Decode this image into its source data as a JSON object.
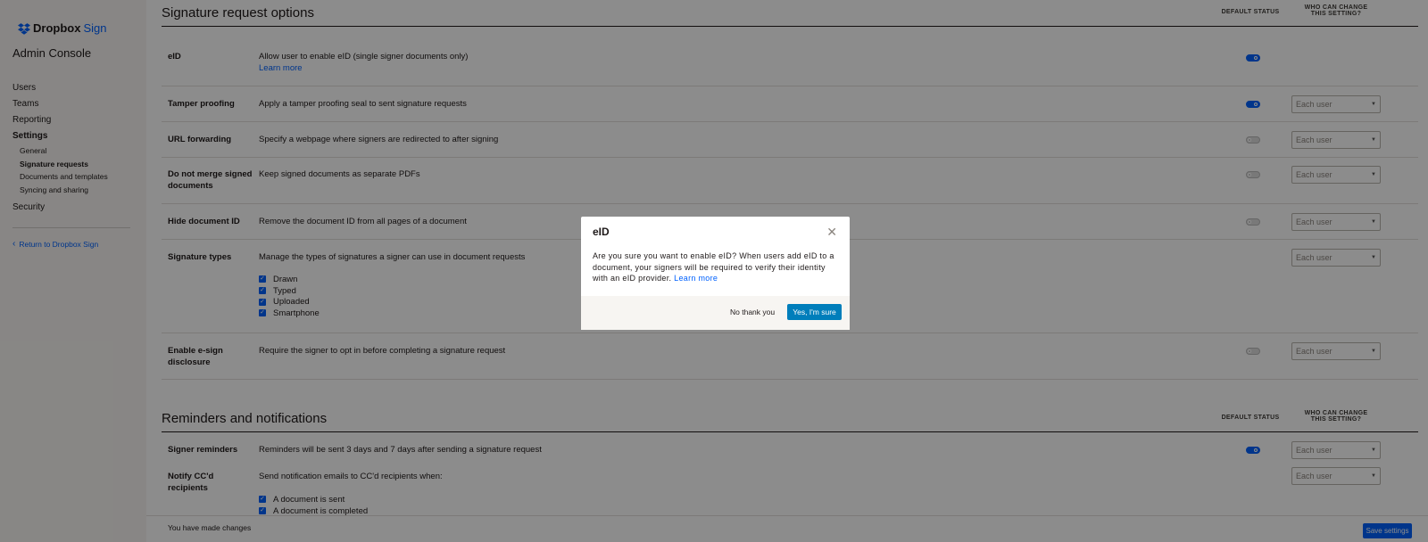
{
  "brand": {
    "name": "Dropbox",
    "product": "Sign",
    "accent": "#0061fe"
  },
  "sidebar": {
    "title": "Admin Console",
    "items": [
      {
        "label": "Users"
      },
      {
        "label": "Teams"
      },
      {
        "label": "Reporting"
      },
      {
        "label": "Settings"
      }
    ],
    "settings_sub": [
      {
        "label": "General"
      },
      {
        "label": "Signature requests"
      },
      {
        "label": "Documents and templates"
      },
      {
        "label": "Syncing and sharing"
      }
    ],
    "security": "Security",
    "return_link": "Return to Dropbox Sign"
  },
  "signature_section": {
    "title": "Signature request options",
    "col_default": "DEFAULT STATUS",
    "col_who": "WHO CAN CHANGE THIS SETTING?",
    "rows": [
      {
        "label": "eID",
        "desc": "Allow user to enable eID (single signer documents only)",
        "link": "Learn more",
        "toggle": "on",
        "select": ""
      },
      {
        "label": "Tamper proofing",
        "desc": "Apply a tamper proofing seal to sent signature requests",
        "toggle": "on",
        "select": "Each user"
      },
      {
        "label": "URL forwarding",
        "desc": "Specify a webpage where signers are redirected to after signing",
        "toggle": "off",
        "select": "Each user"
      },
      {
        "label": "Do not merge signed documents",
        "desc": "Keep signed documents as separate PDFs",
        "toggle": "off",
        "select": "Each user"
      },
      {
        "label": "Hide document ID",
        "desc": "Remove the document ID from all pages of a document",
        "toggle": "off",
        "select": "Each user"
      },
      {
        "label": "Signature types",
        "desc": "Manage the types of signatures a signer can use in document requests",
        "select": "Each user",
        "options": [
          "Drawn",
          "Typed",
          "Uploaded",
          "Smartphone"
        ]
      },
      {
        "label": "Enable e-sign disclosure",
        "desc": "Require the signer to opt in before completing a signature request",
        "toggle": "off",
        "select": "Each user"
      }
    ]
  },
  "reminders_section": {
    "title": "Reminders and notifications",
    "col_default": "DEFAULT STATUS",
    "col_who": "WHO CAN CHANGE THIS SETTING?",
    "rows": [
      {
        "label": "Signer reminders",
        "desc": "Reminders will be sent 3 days and 7 days after sending a signature request",
        "toggle": "on",
        "select": "Each user"
      },
      {
        "label": "Notify CC'd recipients",
        "desc": "Send notification emails to CC'd recipients when:",
        "select": "Each user",
        "options": [
          "A document is sent",
          "A document is completed"
        ]
      }
    ]
  },
  "footer": {
    "changes_text": "You have made changes",
    "save_label": "Save settings"
  },
  "modal": {
    "title": "eID",
    "body": "Are you sure you want to enable eID? When users add eID to a document, your signers will be required to verify their identity with an eID provider. ",
    "link": "Learn more",
    "cancel_label": "No thank you",
    "confirm_label": "Yes, I'm sure"
  }
}
